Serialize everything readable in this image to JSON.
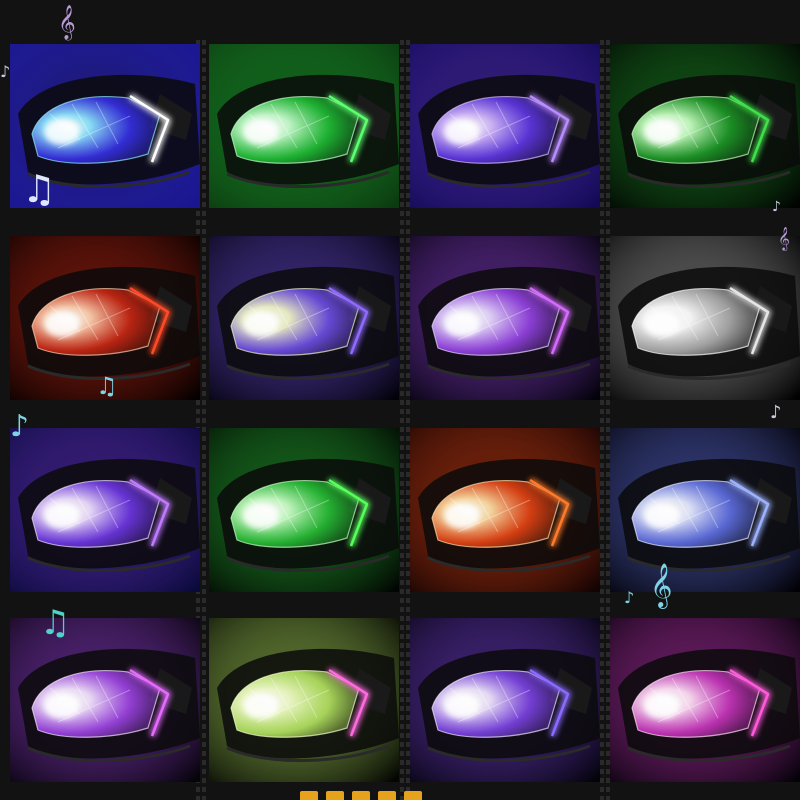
{
  "page": {
    "background": "#121212",
    "accent_note_color": "#7fd3e6"
  },
  "tiles": [
    {
      "bg": "#1a1690",
      "light": "#8fe8ff",
      "strip": "#ffffff",
      "tint": "#3b34ff"
    },
    {
      "bg": "#0c3a10",
      "light": "#c9ffd0",
      "strip": "#5cff6e",
      "tint": "#22d43a"
    },
    {
      "bg": "#120a55",
      "light": "#d9c0ff",
      "strip": "#b98cff",
      "tint": "#6a3cff"
    },
    {
      "bg": "#020302",
      "light": "#c8ffc2",
      "strip": "#3fe04a",
      "tint": "#1faa2a"
    },
    {
      "bg": "#050000",
      "light": "#ffd0b0",
      "strip": "#ff4a28",
      "tint": "#e02a14"
    },
    {
      "bg": "#03020a",
      "light": "#f1f6c8",
      "strip": "#8f6aff",
      "tint": "#7a56ff"
    },
    {
      "bg": "#03020a",
      "light": "#e7d9ff",
      "strip": "#d66aff",
      "tint": "#a64aff"
    },
    {
      "bg": "#020202",
      "light": "#ffffff",
      "strip": "#e6e6e6",
      "tint": "#bfbfbf"
    },
    {
      "bg": "#0a0a3a",
      "light": "#efe0ff",
      "strip": "#c07aff",
      "tint": "#7a3cff"
    },
    {
      "bg": "#020602",
      "light": "#caffc6",
      "strip": "#56ff5a",
      "tint": "#2ad43a"
    },
    {
      "bg": "#140303",
      "light": "#ffe0a8",
      "strip": "#ff7a2a",
      "tint": "#ff4a14"
    },
    {
      "bg": "#020206",
      "light": "#e6ebff",
      "strip": "#9db2ff",
      "tint": "#6a7cff"
    },
    {
      "bg": "#06030a",
      "light": "#f4e4ff",
      "strip": "#e66aff",
      "tint": "#b04aff"
    },
    {
      "bg": "#040602",
      "light": "#f4ffcc",
      "strip": "#ff6ae0",
      "tint": "#c8ff6a"
    },
    {
      "bg": "#04030c",
      "light": "#f0e6ff",
      "strip": "#8a6aff",
      "tint": "#8a4aff"
    },
    {
      "bg": "#06020a",
      "light": "#ffe0f6",
      "strip": "#ff5adc",
      "tint": "#e03ad4"
    }
  ],
  "notes": [
    {
      "glyph": "𝄞",
      "color": "#b59ad6"
    },
    {
      "glyph": "♪",
      "color": "#c8c8e0"
    },
    {
      "glyph": "♫",
      "color": "#dfe6ff"
    },
    {
      "glyph": "♪",
      "color": "#c8c8e0"
    },
    {
      "glyph": "𝄞",
      "color": "#b59ad6"
    },
    {
      "glyph": "♫",
      "color": "#7fd3e6"
    },
    {
      "glyph": "♪",
      "color": "#7fd3e6"
    },
    {
      "glyph": "♪",
      "color": "#c8c8e0"
    },
    {
      "glyph": "♫",
      "color": "#4fd3c8"
    },
    {
      "glyph": "♪",
      "color": "#7fd3e6"
    },
    {
      "glyph": "𝄞",
      "color": "#7fd3e6"
    }
  ]
}
